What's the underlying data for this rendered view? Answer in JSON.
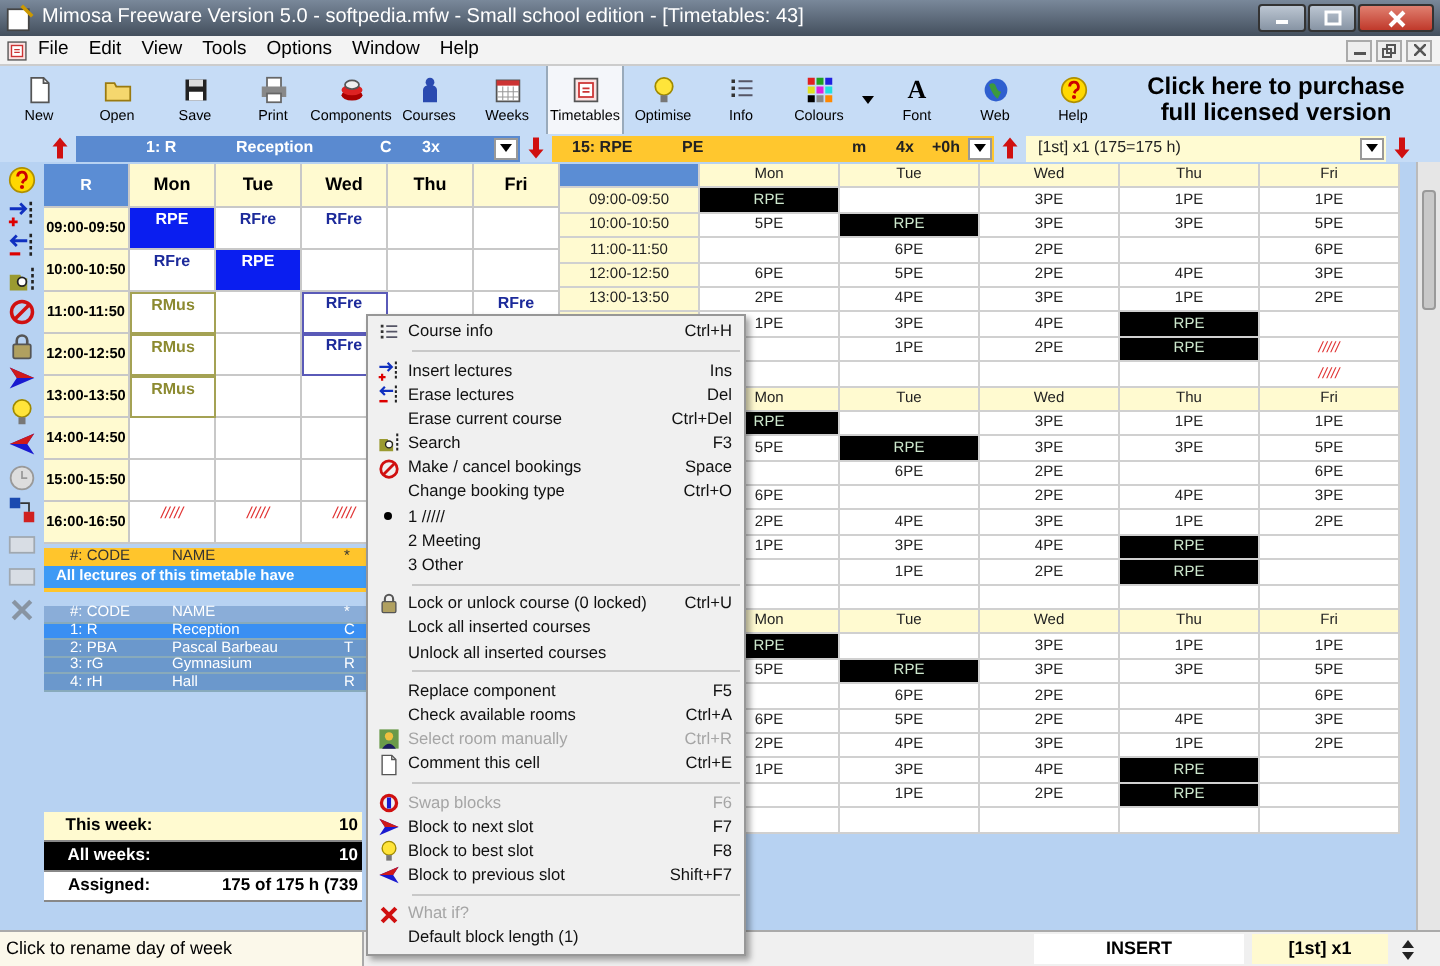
{
  "window": {
    "title": "Mimosa Freeware Version 5.0 - softpedia.mfw - Small school edition - [Timetables: 43]"
  },
  "menu_bar": [
    "File",
    "Edit",
    "View",
    "Tools",
    "Options",
    "Window",
    "Help"
  ],
  "toolbar": [
    {
      "label": "New",
      "selected": false
    },
    {
      "label": "Open",
      "selected": false
    },
    {
      "label": "Save",
      "selected": false
    },
    {
      "label": "Print",
      "selected": false
    },
    {
      "label": "Components",
      "selected": false
    },
    {
      "label": "Courses",
      "selected": false
    },
    {
      "label": "Weeks",
      "selected": false
    },
    {
      "label": "Timetables",
      "selected": true
    },
    {
      "label": "Optimise",
      "selected": false
    },
    {
      "label": "Info",
      "selected": false
    },
    {
      "label": "Colours",
      "selected": false,
      "dropdown": true
    },
    {
      "label": "Font",
      "selected": false,
      "glyph": "A"
    },
    {
      "label": "Web",
      "selected": false
    },
    {
      "label": "Help",
      "selected": false
    }
  ],
  "purchase_banner": [
    "Click here to purchase",
    "full licensed version"
  ],
  "selectors": [
    {
      "kind": "timetable",
      "fields": [
        "1: R",
        "Reception",
        "C",
        "3x"
      ]
    },
    {
      "kind": "course",
      "fields": [
        "15: RPE",
        "PE",
        "m",
        "4x",
        "+0h"
      ]
    },
    {
      "kind": "week",
      "fields": [
        "[1st] x1 (175=175 h)"
      ]
    }
  ],
  "timetable_grid": {
    "corner": "R",
    "days": [
      "Mon",
      "Tue",
      "Wed",
      "Thu",
      "Fri"
    ],
    "rows": [
      {
        "time": "09:00-09:50",
        "cells": [
          {
            "text": "RPE",
            "kind": "current",
            "selected": false
          },
          {
            "text": "RFre",
            "kind": "lecture",
            "selected": false
          },
          {
            "text": "RFre",
            "kind": "lecture",
            "selected": false
          },
          null,
          null
        ]
      },
      {
        "time": "10:00-10:50",
        "cells": [
          {
            "text": "RFre",
            "kind": "lecture",
            "selected": false
          },
          {
            "text": "RPE",
            "kind": "current",
            "selected": false
          },
          null,
          null,
          null
        ]
      },
      {
        "time": "11:00-11:50",
        "cells": [
          {
            "text": "RMus",
            "kind": "framed",
            "selected": false
          },
          null,
          {
            "text": "RFre",
            "kind": "lecture",
            "selected": true
          },
          null,
          {
            "text": "RFre",
            "kind": "lecture",
            "selected": false
          }
        ]
      },
      {
        "time": "12:00-12:50",
        "cells": [
          {
            "text": "RMus",
            "kind": "framed",
            "selected": false
          },
          null,
          {
            "text": "RFre",
            "kind": "lecture",
            "selected": true
          },
          null,
          null
        ]
      },
      {
        "time": "13:00-13:50",
        "cells": [
          {
            "text": "RMus",
            "kind": "framed",
            "selected": false
          },
          null,
          null,
          null,
          null
        ]
      },
      {
        "time": "14:00-14:50",
        "cells": [
          null,
          null,
          null,
          null,
          null
        ]
      },
      {
        "time": "15:00-15:50",
        "cells": [
          null,
          null,
          null,
          null,
          null
        ]
      },
      {
        "time": "16:00-16:50",
        "cells": [
          {
            "text": "/////",
            "kind": "booking",
            "selected": false
          },
          {
            "text": "/////",
            "kind": "booking",
            "selected": false
          },
          {
            "text": "/////",
            "kind": "booking",
            "selected": false
          },
          null,
          null
        ]
      }
    ]
  },
  "component_bar": {
    "columns": [
      "#: CODE",
      "NAME",
      "*"
    ],
    "banner": "All lectures of this timetable have"
  },
  "components": {
    "columns": [
      "#: CODE",
      "NAME",
      "*"
    ],
    "rows": [
      {
        "code": "1: R",
        "name": "Reception",
        "type": "C",
        "selected": true
      },
      {
        "code": "2: PBA",
        "name": "Pascal Barbeau",
        "type": "T",
        "selected": false
      },
      {
        "code": "3: rG",
        "name": "Gymnasium",
        "type": "R",
        "selected": false
      },
      {
        "code": "4: rH",
        "name": "Hall",
        "type": "R",
        "selected": false
      }
    ]
  },
  "stats": [
    {
      "kind": "week",
      "label": "This week:",
      "value": "10"
    },
    {
      "kind": "total",
      "label": "All weeks:",
      "value": "10"
    },
    {
      "kind": "assigned",
      "label": "Assigned:",
      "value": "175 of 175 h (739"
    }
  ],
  "week_tables": [
    {
      "days": [
        "Mon",
        "Tue",
        "Wed",
        "Thu",
        "Fri"
      ],
      "rows": [
        {
          "time": "09:00-09:50",
          "cells": [
            {
              "text": "RPE",
              "kind": "current"
            },
            null,
            {
              "text": "3PE",
              "kind": "lecture"
            },
            {
              "text": "1PE",
              "kind": "lecture"
            },
            {
              "text": "1PE",
              "kind": "lecture"
            }
          ]
        },
        {
          "time": "10:00-10:50",
          "cells": [
            {
              "text": "5PE",
              "kind": "lecture"
            },
            {
              "text": "RPE",
              "kind": "current"
            },
            {
              "text": "3PE",
              "kind": "lecture"
            },
            {
              "text": "3PE",
              "kind": "lecture"
            },
            {
              "text": "5PE",
              "kind": "lecture"
            }
          ]
        },
        {
          "time": "11:00-11:50",
          "cells": [
            null,
            {
              "text": "6PE",
              "kind": "lecture"
            },
            {
              "text": "2PE",
              "kind": "lecture"
            },
            null,
            {
              "text": "6PE",
              "kind": "lecture"
            }
          ]
        },
        {
          "time": "12:00-12:50",
          "cells": [
            {
              "text": "6PE",
              "kind": "lecture"
            },
            {
              "text": "5PE",
              "kind": "lecture"
            },
            {
              "text": "2PE",
              "kind": "lecture"
            },
            {
              "text": "4PE",
              "kind": "lecture"
            },
            {
              "text": "3PE",
              "kind": "lecture"
            }
          ]
        },
        {
          "time": "13:00-13:50",
          "cells": [
            {
              "text": "2PE",
              "kind": "lecture"
            },
            {
              "text": "4PE",
              "kind": "lecture"
            },
            {
              "text": "3PE",
              "kind": "lecture"
            },
            {
              "text": "1PE",
              "kind": "lecture"
            },
            {
              "text": "2PE",
              "kind": "lecture"
            }
          ]
        },
        {
          "cells": [
            {
              "text": "1PE",
              "kind": "lecture"
            },
            {
              "text": "3PE",
              "kind": "lecture"
            },
            {
              "text": "4PE",
              "kind": "lecture"
            },
            {
              "text": "RPE",
              "kind": "current"
            },
            null
          ]
        },
        {
          "cells": [
            null,
            {
              "text": "1PE",
              "kind": "lecture"
            },
            {
              "text": "2PE",
              "kind": "lecture"
            },
            {
              "text": "RPE",
              "kind": "current"
            },
            {
              "text": "/////",
              "kind": "booking"
            }
          ]
        },
        {
          "cells": [
            null,
            null,
            null,
            null,
            {
              "text": "/////",
              "kind": "booking"
            }
          ]
        }
      ]
    },
    {
      "days": [
        "Mon",
        "Tue",
        "Wed",
        "Thu",
        "Fri"
      ],
      "rows": [
        {
          "cells": [
            {
              "text": "RPE",
              "kind": "current"
            },
            null,
            {
              "text": "3PE",
              "kind": "lecture"
            },
            {
              "text": "1PE",
              "kind": "lecture"
            },
            {
              "text": "1PE",
              "kind": "lecture"
            }
          ]
        },
        {
          "cells": [
            {
              "text": "5PE",
              "kind": "lecture"
            },
            {
              "text": "RPE",
              "kind": "current"
            },
            {
              "text": "3PE",
              "kind": "lecture"
            },
            {
              "text": "3PE",
              "kind": "lecture"
            },
            {
              "text": "5PE",
              "kind": "lecture"
            }
          ]
        },
        {
          "cells": [
            null,
            {
              "text": "6PE",
              "kind": "lecture"
            },
            {
              "text": "2PE",
              "kind": "lecture"
            },
            null,
            {
              "text": "6PE",
              "kind": "lecture"
            }
          ]
        },
        {
          "cells": [
            {
              "text": "6PE",
              "kind": "lecture"
            },
            null,
            {
              "text": "2PE",
              "kind": "lecture"
            },
            {
              "text": "4PE",
              "kind": "lecture"
            },
            {
              "text": "3PE",
              "kind": "lecture"
            }
          ]
        },
        {
          "cells": [
            {
              "text": "2PE",
              "kind": "lecture"
            },
            {
              "text": "4PE",
              "kind": "lecture"
            },
            {
              "text": "3PE",
              "kind": "lecture"
            },
            {
              "text": "1PE",
              "kind": "lecture"
            },
            {
              "text": "2PE",
              "kind": "lecture"
            }
          ]
        },
        {
          "cells": [
            {
              "text": "1PE",
              "kind": "lecture"
            },
            {
              "text": "3PE",
              "kind": "lecture"
            },
            {
              "text": "4PE",
              "kind": "lecture"
            },
            {
              "text": "RPE",
              "kind": "current"
            },
            null
          ]
        },
        {
          "cells": [
            null,
            {
              "text": "1PE",
              "kind": "lecture"
            },
            {
              "text": "2PE",
              "kind": "lecture"
            },
            {
              "text": "RPE",
              "kind": "current"
            },
            null
          ]
        },
        {
          "cells": [
            null,
            null,
            null,
            null,
            null
          ]
        }
      ]
    },
    {
      "days": [
        "Mon",
        "Tue",
        "Wed",
        "Thu",
        "Fri"
      ],
      "rows": [
        {
          "cells": [
            {
              "text": "RPE",
              "kind": "current"
            },
            null,
            {
              "text": "3PE",
              "kind": "lecture"
            },
            {
              "text": "1PE",
              "kind": "lecture"
            },
            {
              "text": "1PE",
              "kind": "lecture"
            }
          ]
        },
        {
          "cells": [
            {
              "text": "5PE",
              "kind": "lecture"
            },
            {
              "text": "RPE",
              "kind": "current"
            },
            {
              "text": "3PE",
              "kind": "lecture"
            },
            {
              "text": "3PE",
              "kind": "lecture"
            },
            {
              "text": "5PE",
              "kind": "lecture"
            }
          ]
        },
        {
          "cells": [
            null,
            {
              "text": "6PE",
              "kind": "lecture"
            },
            {
              "text": "2PE",
              "kind": "lecture"
            },
            null,
            {
              "text": "6PE",
              "kind": "lecture"
            }
          ]
        },
        {
          "cells": [
            {
              "text": "6PE",
              "kind": "lecture"
            },
            {
              "text": "5PE",
              "kind": "lecture"
            },
            {
              "text": "2PE",
              "kind": "lecture"
            },
            {
              "text": "4PE",
              "kind": "lecture"
            },
            {
              "text": "3PE",
              "kind": "lecture"
            }
          ]
        },
        {
          "cells": [
            {
              "text": "2PE",
              "kind": "lecture"
            },
            {
              "text": "4PE",
              "kind": "lecture"
            },
            {
              "text": "3PE",
              "kind": "lecture"
            },
            {
              "text": "1PE",
              "kind": "lecture"
            },
            {
              "text": "2PE",
              "kind": "lecture"
            }
          ]
        },
        {
          "cells": [
            {
              "text": "1PE",
              "kind": "lecture"
            },
            {
              "text": "3PE",
              "kind": "lecture"
            },
            {
              "text": "4PE",
              "kind": "lecture"
            },
            {
              "text": "RPE",
              "kind": "current"
            },
            null
          ]
        },
        {
          "cells": [
            null,
            {
              "text": "1PE",
              "kind": "lecture"
            },
            {
              "text": "2PE",
              "kind": "lecture"
            },
            {
              "text": "RPE",
              "kind": "current"
            },
            null
          ]
        },
        {
          "cells": [
            null,
            null,
            null,
            null,
            null
          ]
        }
      ]
    }
  ],
  "context_menu": [
    {
      "kind": "item",
      "label": "Course info",
      "shortcut": "Ctrl+H",
      "disabled": false
    },
    {
      "kind": "separator"
    },
    {
      "kind": "item",
      "label": "Insert lectures",
      "shortcut": "Ins",
      "disabled": false
    },
    {
      "kind": "item",
      "label": "Erase lectures",
      "shortcut": "Del",
      "disabled": false
    },
    {
      "kind": "item",
      "label": "Erase current course",
      "shortcut": "Ctrl+Del",
      "disabled": false
    },
    {
      "kind": "item",
      "label": "Search",
      "shortcut": "F3",
      "disabled": false
    },
    {
      "kind": "item",
      "label": "Make / cancel bookings",
      "shortcut": "Space",
      "disabled": false
    },
    {
      "kind": "item",
      "label": "Change booking type",
      "shortcut": "Ctrl+O",
      "disabled": false
    },
    {
      "kind": "radio",
      "label": "1 /////",
      "checked": true,
      "disabled": false
    },
    {
      "kind": "radio",
      "label": "2 Meeting",
      "checked": false,
      "disabled": false
    },
    {
      "kind": "radio",
      "label": "3 Other",
      "checked": false,
      "disabled": false
    },
    {
      "kind": "separator"
    },
    {
      "kind": "item",
      "label": "Lock or unlock course (0 locked)",
      "shortcut": "Ctrl+U",
      "disabled": false
    },
    {
      "kind": "item",
      "label": "Lock all inserted courses",
      "disabled": false
    },
    {
      "kind": "item",
      "label": "Unlock all inserted courses",
      "disabled": false
    },
    {
      "kind": "separator"
    },
    {
      "kind": "item",
      "label": "Replace component",
      "shortcut": "F5",
      "disabled": false
    },
    {
      "kind": "item",
      "label": "Check available rooms",
      "shortcut": "Ctrl+A",
      "disabled": false
    },
    {
      "kind": "item",
      "label": "Select room manually",
      "shortcut": "Ctrl+R",
      "disabled": true
    },
    {
      "kind": "item",
      "label": "Comment this cell",
      "shortcut": "Ctrl+E",
      "disabled": false
    },
    {
      "kind": "separator"
    },
    {
      "kind": "item",
      "label": "Swap blocks",
      "shortcut": "F6",
      "disabled": true
    },
    {
      "kind": "item",
      "label": "Block to next slot",
      "shortcut": "F7",
      "disabled": false
    },
    {
      "kind": "item",
      "label": "Block to best slot",
      "shortcut": "F8",
      "disabled": false
    },
    {
      "kind": "item",
      "label": "Block to previous slot",
      "shortcut": "Shift+F7",
      "disabled": false
    },
    {
      "kind": "separator"
    },
    {
      "kind": "item",
      "label": "What if?",
      "disabled": true
    },
    {
      "kind": "item",
      "label": "Default block length (1)",
      "disabled": false
    }
  ],
  "status_bar": {
    "hint": "Click to rename day of week",
    "mode": "INSERT",
    "week": "[1st] x1"
  }
}
